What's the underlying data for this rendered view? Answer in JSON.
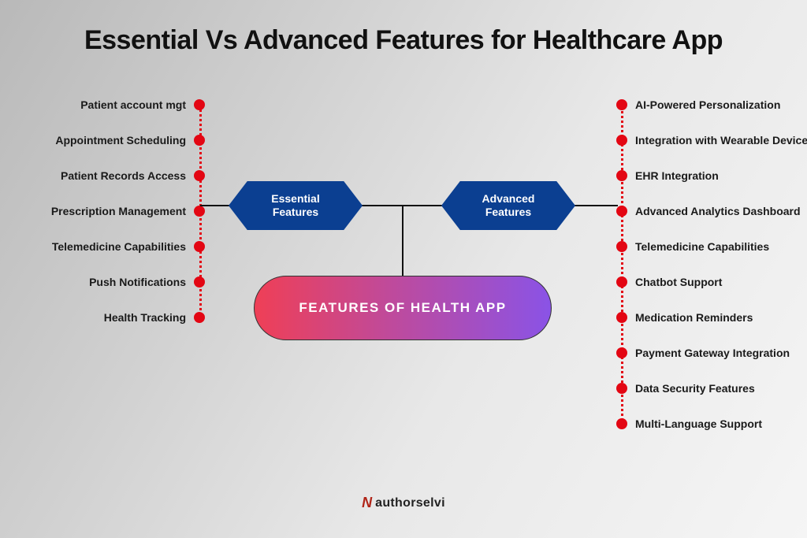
{
  "title": "Essential Vs Advanced Features for Healthcare App",
  "hex": {
    "left": "Essential\nFeatures",
    "right": "Advanced\nFeatures"
  },
  "pill": "FEATURES OF HEALTH APP",
  "left_items": [
    "Patient account mgt",
    "Appointment Scheduling",
    "Patient Records Access",
    "Prescription Management",
    "Telemedicine Capabilities",
    "Push Notifications",
    "Health Tracking"
  ],
  "right_items": [
    "AI-Powered Personalization",
    "Integration with Wearable Devices",
    "EHR Integration",
    "Advanced Analytics Dashboard",
    "Telemedicine Capabilities",
    "Chatbot Support",
    "Medication Reminders",
    "Payment Gateway Integration",
    "Data Security Features",
    "Multi-Language Support"
  ],
  "brand": {
    "mark": "N",
    "name": "authorselvi"
  },
  "colors": {
    "accent": "#0b3f91",
    "bullet": "#e30613"
  }
}
